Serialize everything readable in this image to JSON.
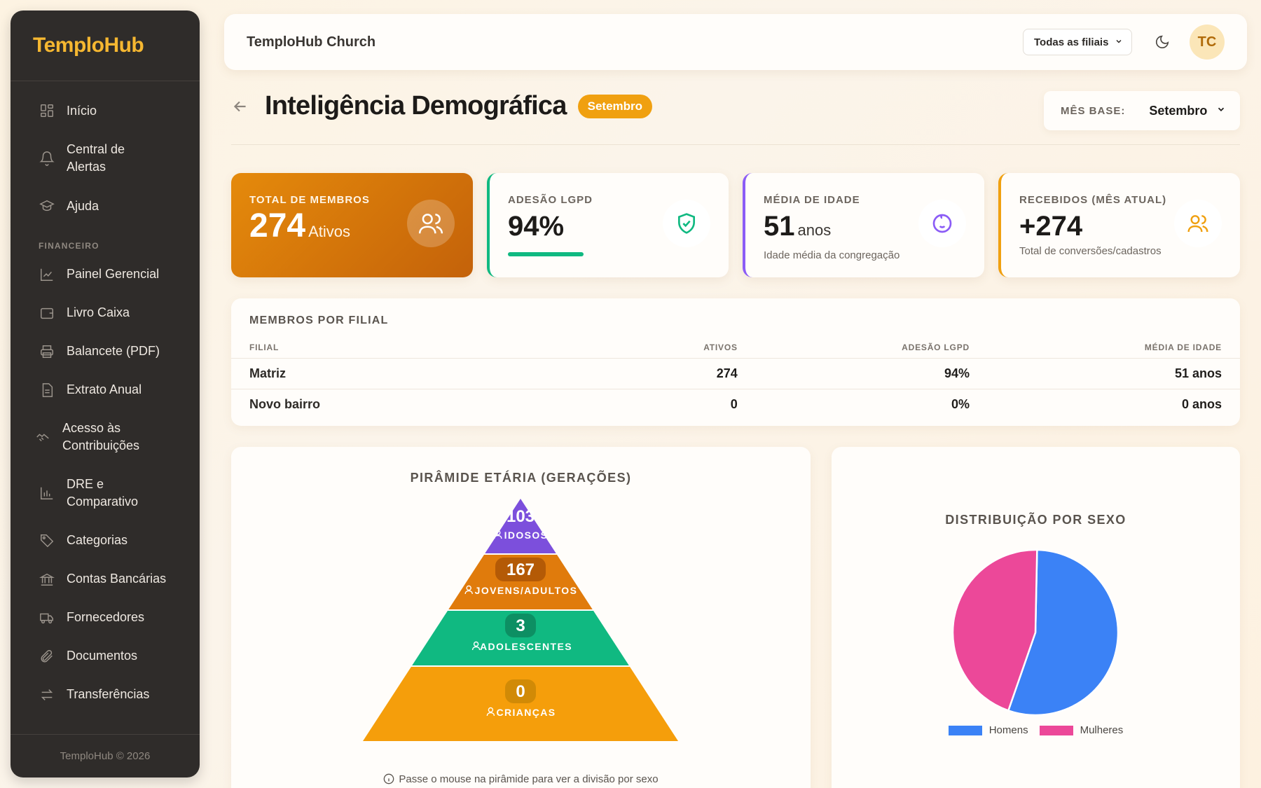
{
  "sidebar": {
    "brand": "TemploHub",
    "items_top": [
      {
        "label": "Início",
        "icon": "grid-icon"
      },
      {
        "label": "Central de Alertas",
        "icon": "bell-icon"
      },
      {
        "label": "Ajuda",
        "icon": "graduation-cap-icon"
      }
    ],
    "section_financeiro": "FINANCEIRO",
    "items_fin": [
      {
        "label": "Painel Gerencial",
        "icon": "line-chart-icon"
      },
      {
        "label": "Livro Caixa",
        "icon": "wallet-icon"
      },
      {
        "label": "Balancete (PDF)",
        "icon": "printer-icon"
      },
      {
        "label": "Extrato Anual",
        "icon": "document-icon"
      },
      {
        "label": "Acesso às Contribuições",
        "icon": "handshake-icon"
      },
      {
        "label": "DRE e Comparativo",
        "icon": "bar-chart-icon"
      },
      {
        "label": "Categorias",
        "icon": "tag-icon"
      },
      {
        "label": "Contas Bancárias",
        "icon": "bank-icon"
      },
      {
        "label": "Fornecedores",
        "icon": "truck-icon"
      },
      {
        "label": "Documentos",
        "icon": "paperclip-icon"
      },
      {
        "label": "Transferências",
        "icon": "arrows-swap-icon"
      }
    ],
    "footer": "TemploHub © 2026"
  },
  "header": {
    "org_name": "TemploHub Church",
    "branch_select": "Todas as filiais",
    "avatar_initials": "TC"
  },
  "page": {
    "title": "Inteligência Demográfica",
    "month_pill": "Setembro",
    "month_base_label": "MÊS BASE:",
    "month_base_value": "Setembro"
  },
  "kpis": {
    "total": {
      "label": "TOTAL DE MEMBROS",
      "value": "274",
      "unit": "Ativos"
    },
    "lgpd": {
      "label": "ADESÃO LGPD",
      "value": "94%",
      "progress": 0.94
    },
    "age": {
      "label": "MÉDIA DE IDADE",
      "value": "51",
      "unit": "anos",
      "sub": "Idade média da congregação"
    },
    "received": {
      "label": "RECEBIDOS (MÊS ATUAL)",
      "value": "+274",
      "sub": "Total de conversões/cadastros"
    }
  },
  "branches_table": {
    "title": "MEMBROS POR FILIAL",
    "columns": [
      "FILIAL",
      "ATIVOS",
      "ADESÃO LGPD",
      "MÉDIA DE IDADE"
    ],
    "rows": [
      [
        "Matriz",
        "274",
        "94%",
        "51 anos"
      ],
      [
        "Novo bairro",
        "0",
        "0%",
        "0 anos"
      ]
    ]
  },
  "pyramid": {
    "title": "PIRÂMIDE ETÁRIA (GERAÇÕES)",
    "levels": [
      {
        "label": "IDOSOS",
        "value": "103",
        "color": "#7c4fdc"
      },
      {
        "label": "JOVENS/ADULTOS",
        "value": "167",
        "color": "#e07b0c"
      },
      {
        "label": "ADOLESCENTES",
        "value": "3",
        "color": "#10b981"
      },
      {
        "label": "CRIANÇAS",
        "value": "0",
        "color": "#f59e0b"
      }
    ],
    "hint": "Passe o mouse na pirâmide para ver a divisão por sexo"
  },
  "chart_data": {
    "type": "pie",
    "title": "DISTRIBUIÇÃO POR SEXO",
    "categories": [
      "Homens",
      "Mulheres"
    ],
    "values": [
      55,
      45
    ],
    "colors": [
      "#3b82f6",
      "#ec4899"
    ],
    "legend": "bottom"
  }
}
